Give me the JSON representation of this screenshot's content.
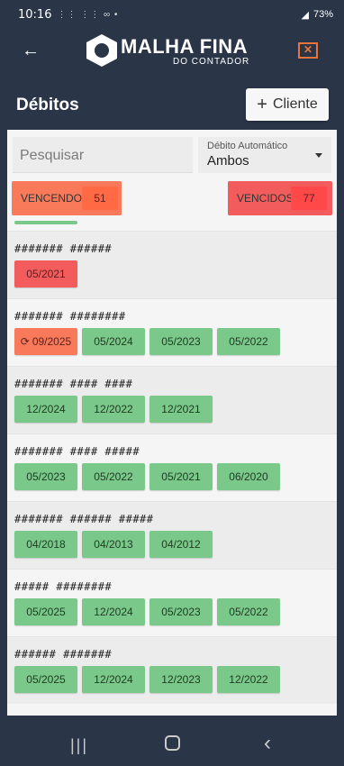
{
  "status": {
    "time": "10:16",
    "left_icons": "⋮⋮ ⋮⋮ ∞ •",
    "battery": "73%"
  },
  "app": {
    "logo_main": "MALHA FINA",
    "logo_sub": "DO CONTADOR",
    "close_icon": "close-icon",
    "back_icon": "back-arrow-icon"
  },
  "card": {
    "title": "Débitos",
    "add_label": "Cliente"
  },
  "filters": {
    "search_placeholder": "Pesquisar",
    "select_label": "Débito Automático",
    "select_value": "Ambos"
  },
  "counters": {
    "vencendo_label": "VENCENDO",
    "vencendo_count": "51",
    "vencidos_label": "VENCIDOS",
    "vencidos_count": "77"
  },
  "colors": {
    "header": "#2a3548",
    "green": "#7bc98a",
    "red": "#f25c5c",
    "orange": "#f97a5a",
    "accent": "#e9753a"
  },
  "clients": [
    {
      "name": "####### ######",
      "chips": [
        {
          "label": "05/2021",
          "status": "red"
        }
      ]
    },
    {
      "name": "####### ########",
      "chips": [
        {
          "label": "09/2025",
          "status": "orange",
          "refresh": true
        },
        {
          "label": "05/2024",
          "status": "green"
        },
        {
          "label": "05/2023",
          "status": "green"
        },
        {
          "label": "05/2022",
          "status": "green"
        }
      ]
    },
    {
      "name": "####### #### ####",
      "chips": [
        {
          "label": "12/2024",
          "status": "green"
        },
        {
          "label": "12/2022",
          "status": "green"
        },
        {
          "label": "12/2021",
          "status": "green"
        }
      ]
    },
    {
      "name": "####### #### #####",
      "chips": [
        {
          "label": "05/2023",
          "status": "green"
        },
        {
          "label": "05/2022",
          "status": "green"
        },
        {
          "label": "05/2021",
          "status": "green"
        },
        {
          "label": "06/2020",
          "status": "green"
        }
      ]
    },
    {
      "name": "####### ###### #####",
      "chips": [
        {
          "label": "04/2018",
          "status": "green"
        },
        {
          "label": "04/2013",
          "status": "green"
        },
        {
          "label": "04/2012",
          "status": "green"
        }
      ]
    },
    {
      "name": "##### ########",
      "chips": [
        {
          "label": "05/2025",
          "status": "green"
        },
        {
          "label": "12/2024",
          "status": "green"
        },
        {
          "label": "05/2023",
          "status": "green"
        },
        {
          "label": "05/2022",
          "status": "green"
        }
      ]
    },
    {
      "name": "###### #######",
      "chips": [
        {
          "label": "05/2025",
          "status": "green"
        },
        {
          "label": "12/2024",
          "status": "green"
        },
        {
          "label": "12/2023",
          "status": "green"
        },
        {
          "label": "12/2022",
          "status": "green"
        }
      ]
    }
  ]
}
